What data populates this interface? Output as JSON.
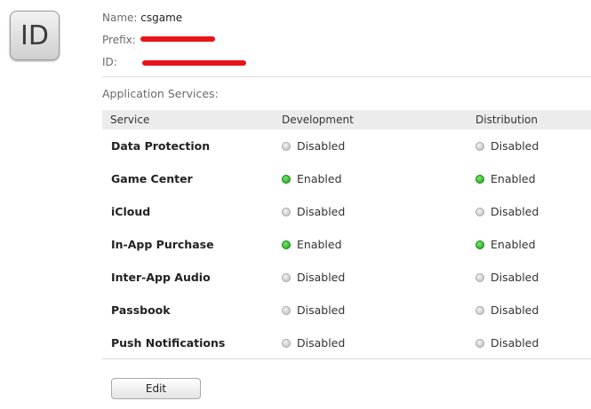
{
  "icon": {
    "text": "ID"
  },
  "meta": {
    "name_label": "Name:",
    "name_value": "csgame",
    "prefix_label": "Prefix:",
    "id_label": "ID:"
  },
  "section_title": "Application Services:",
  "table": {
    "columns": [
      "Service",
      "Development",
      "Distribution"
    ],
    "rows": [
      {
        "service": "Data Protection",
        "development": "Disabled",
        "distribution": "Disabled"
      },
      {
        "service": "Game Center",
        "development": "Enabled",
        "distribution": "Enabled"
      },
      {
        "service": "iCloud",
        "development": "Disabled",
        "distribution": "Disabled"
      },
      {
        "service": "In-App Purchase",
        "development": "Enabled",
        "distribution": "Enabled"
      },
      {
        "service": "Inter-App Audio",
        "development": "Disabled",
        "distribution": "Disabled"
      },
      {
        "service": "Passbook",
        "development": "Disabled",
        "distribution": "Disabled"
      },
      {
        "service": "Push Notifications",
        "development": "Disabled",
        "distribution": "Disabled"
      }
    ]
  },
  "colors": {
    "enabled": "#1aa11a",
    "disabled": "#b8b8b8",
    "redaction": "#e8141a"
  },
  "edit_label": "Edit"
}
